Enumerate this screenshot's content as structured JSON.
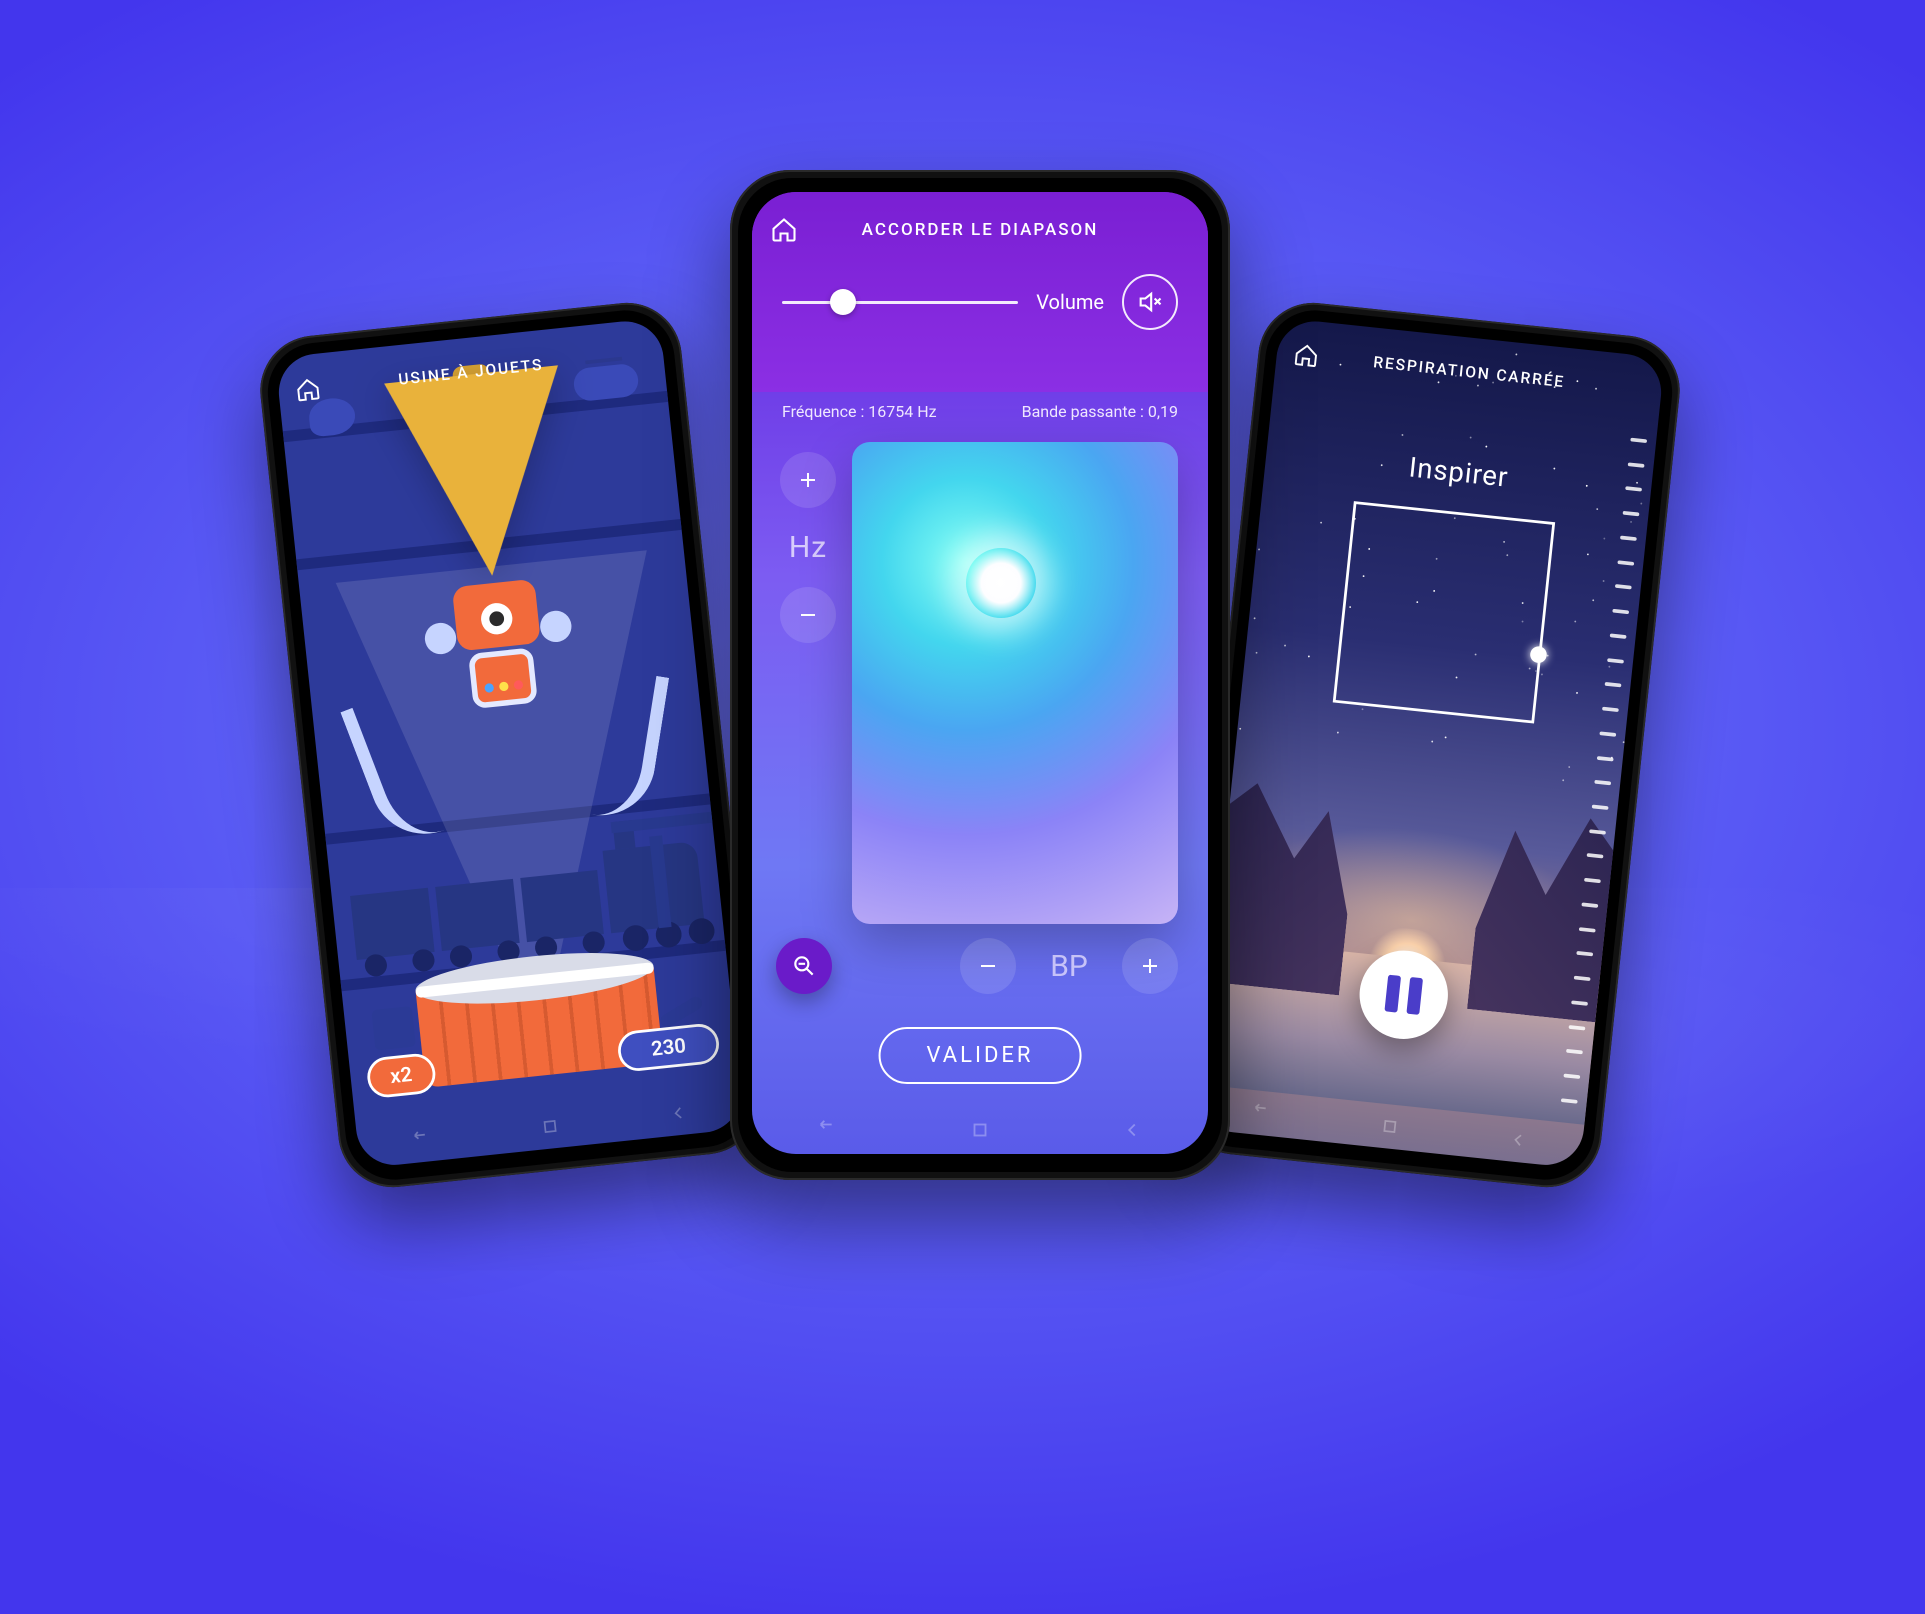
{
  "left": {
    "title": "USINE À JOUETS",
    "multiplier": "x2",
    "score": "230",
    "robot_dot_colors": [
      "#4aa3ff",
      "#ffe04a",
      "#ff5a5a"
    ]
  },
  "center": {
    "title": "ACCORDER LE DIAPASON",
    "volume_label": "Volume",
    "volume_value_pct": 26,
    "frequency_label": "Fréquence : 16754 Hz",
    "bandwidth_label": "Bande passante : 0,19",
    "hz_label": "Hz",
    "bp_label": "BP",
    "validate": "VALIDER"
  },
  "right": {
    "title": "RESPIRATION CARRÉE",
    "instruction": "Inspirer",
    "tick_count": 28
  }
}
